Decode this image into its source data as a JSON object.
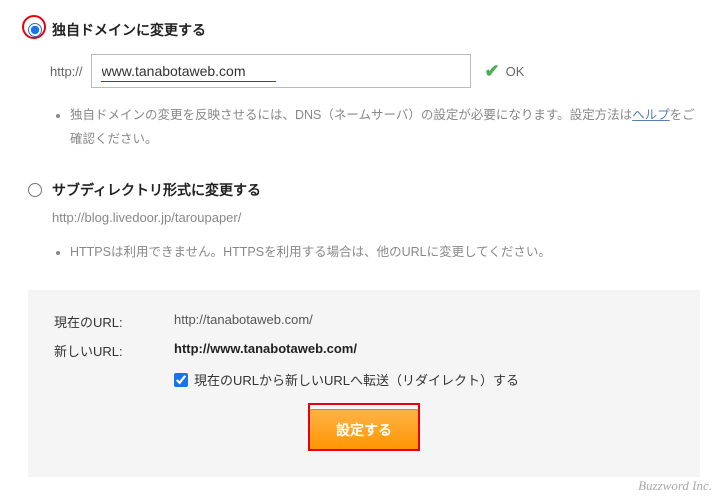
{
  "option1": {
    "label": "独自ドメインに変更する",
    "protocol": "http://",
    "domain_value": "www.tanabotaweb.com",
    "ok": "OK",
    "note_before": "独自ドメインの変更を反映させるには、DNS（ネームサーバ）の設定が必要になります。設定方法は",
    "note_link": "ヘルプ",
    "note_after": "をご確認ください。"
  },
  "option2": {
    "label": "サブディレクトリ形式に変更する",
    "url": "http://blog.livedoor.jp/taroupaper/",
    "note": "HTTPSは利用できません。HTTPSを利用する場合は、他のURLに変更してください。"
  },
  "panel": {
    "current_key": "現在のURL:",
    "current_val": "http://tanabotaweb.com/",
    "new_key": "新しいURL:",
    "new_val": "http://www.tanabotaweb.com/",
    "redirect_label": "現在のURLから新しいURLへ転送（リダイレクト）する"
  },
  "submit": "設定する",
  "footer": "Buzzword Inc."
}
